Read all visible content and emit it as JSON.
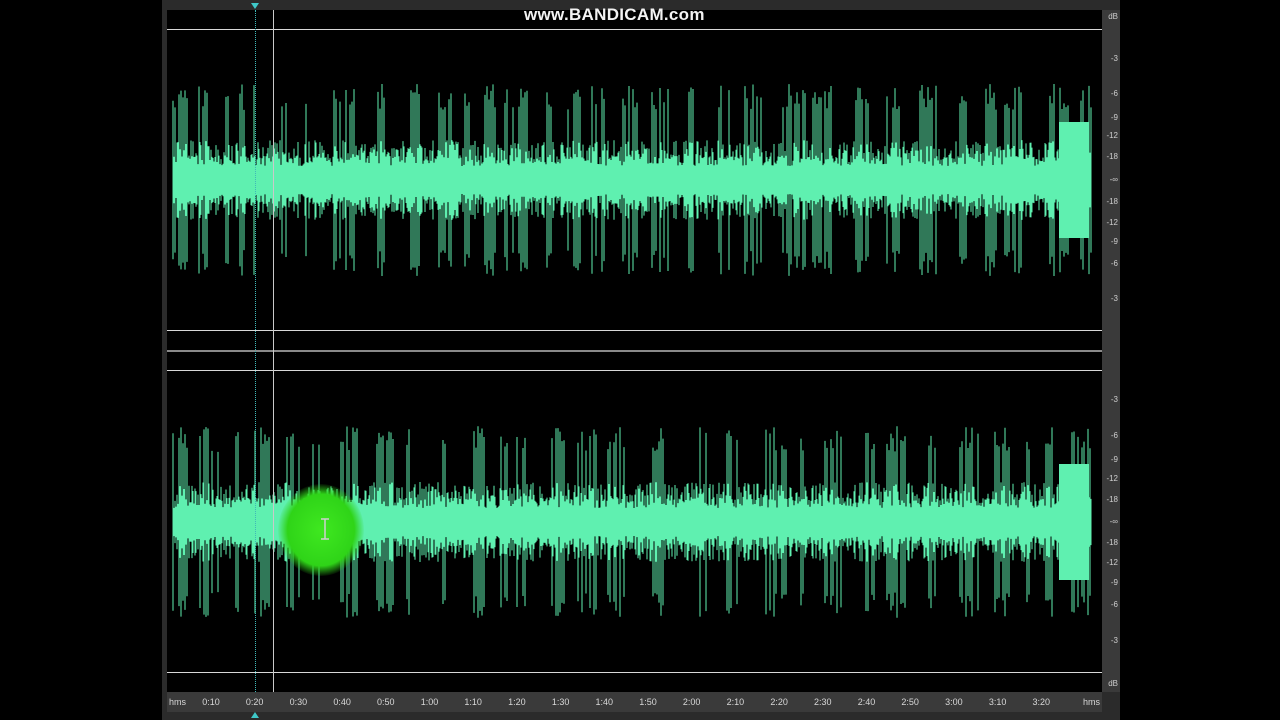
{
  "app": {
    "watermark": "www.BANDICAM.com"
  },
  "colors": {
    "waveform": "#5ff0b0",
    "background": "#000000",
    "selection_blob": "#33e01c",
    "cursor_marker": "#3fc8c8"
  },
  "db_ruler": {
    "unit_top": "dB",
    "unit_bottom": "dB",
    "top_channel_labels": [
      "-3",
      "-6",
      "-9",
      "-12",
      "-18",
      "-∞",
      "-18",
      "-12",
      "-9",
      "-6",
      "-3"
    ],
    "bottom_channel_labels": [
      "-3",
      "-6",
      "-9",
      "-12",
      "-18",
      "-∞",
      "-18",
      "-12",
      "-9",
      "-6",
      "-3"
    ]
  },
  "time_ruler": {
    "unit_left": "hms",
    "unit_right": "hms",
    "labels": [
      "0:10",
      "0:20",
      "0:30",
      "0:40",
      "0:50",
      "1:00",
      "1:10",
      "1:20",
      "1:30",
      "1:40",
      "1:50",
      "2:00",
      "2:10",
      "2:20",
      "2:30",
      "2:40",
      "2:50",
      "3:00",
      "3:10",
      "3:20"
    ]
  },
  "icons": {
    "cursor_top": "triangle-down-marker-icon",
    "cursor_bottom": "triangle-up-marker-icon",
    "text_cursor": "i-beam-cursor-icon"
  }
}
